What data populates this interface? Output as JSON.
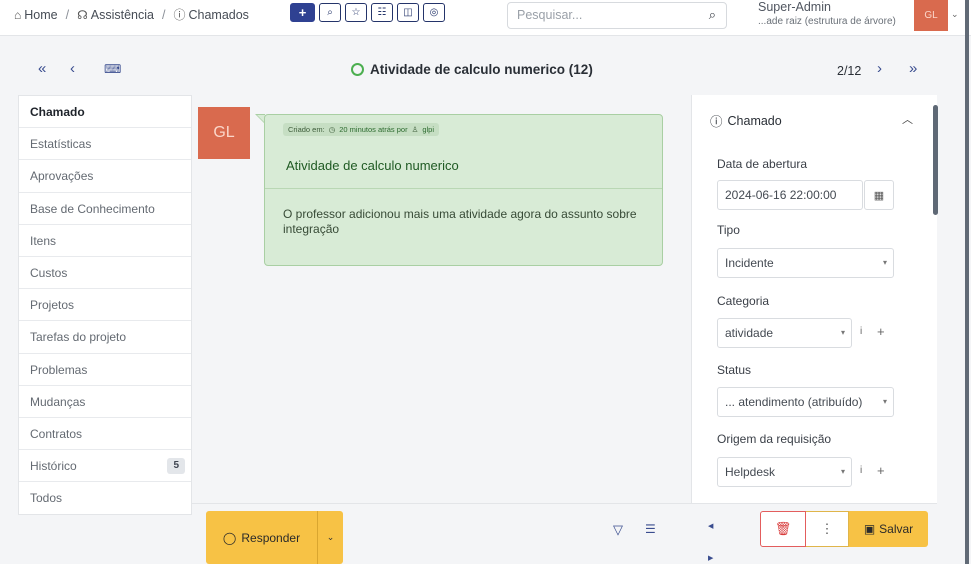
{
  "header": {
    "breadcrumbs": [
      {
        "icon": "home-icon",
        "label": "Home"
      },
      {
        "icon": "assistance-icon",
        "label": "Assistência"
      },
      {
        "icon": "tickets-icon",
        "label": "Chamados"
      }
    ],
    "toolbar_buttons": [
      "add-icon",
      "search-icon",
      "star-icon",
      "list-icon",
      "columns-icon",
      "eye-icon"
    ],
    "search_placeholder": "Pesquisar...",
    "user_name": "Super-Admin",
    "user_entity": "...ade raiz (estrutura de árvore)",
    "user_initials": "GL"
  },
  "navigation": {
    "ticket_title": "Atividade de calculo numerico (12)",
    "pager": "2/12",
    "status_color": "#4caf50"
  },
  "left_tabs": [
    {
      "label": "Chamado",
      "active": true
    },
    {
      "label": "Estatísticas"
    },
    {
      "label": "Aprovações"
    },
    {
      "label": "Base de Conhecimento"
    },
    {
      "label": "Itens"
    },
    {
      "label": "Custos"
    },
    {
      "label": "Projetos"
    },
    {
      "label": "Tarefas do projeto"
    },
    {
      "label": "Problemas"
    },
    {
      "label": "Mudanças"
    },
    {
      "label": "Contratos"
    },
    {
      "label": "Histórico",
      "badge": "5"
    },
    {
      "label": "Todos"
    }
  ],
  "timeline": {
    "avatar_initials": "GL",
    "meta_created": "Criado em:",
    "meta_time": "20 minutos atrás por",
    "meta_user": "glpi",
    "title": "Atividade de calculo numerico",
    "body": "O professor adicionou mais uma atividade agora do assunto sobre integração"
  },
  "right_panel": {
    "section_title": "Chamado",
    "open_date_label": "Data de abertura",
    "open_date_value": "2024-06-16 22:00:00",
    "type_label": "Tipo",
    "type_value": "Incidente",
    "category_label": "Categoria",
    "category_value": "atividade",
    "status_label": "Status",
    "status_value": "... atendimento (atribuído)",
    "origin_label": "Origem da requisição",
    "origin_value": "Helpdesk"
  },
  "actions": {
    "reply_label": "Responder",
    "save_label": "Salvar"
  },
  "colors": {
    "accent_yellow": "#f7c245",
    "avatar_orange": "#d96a4e",
    "followup_green": "#d8ebd6",
    "primary_blue": "#2f4192",
    "danger_red": "#d83b3b"
  }
}
